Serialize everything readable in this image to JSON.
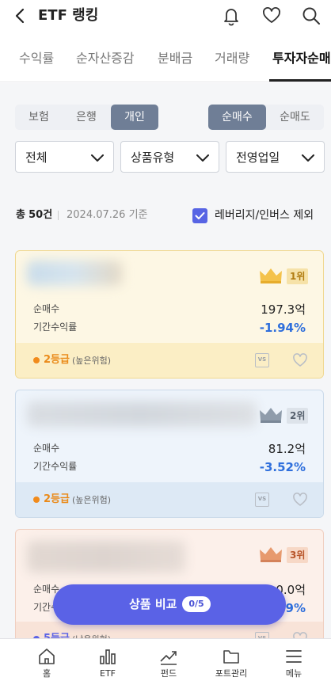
{
  "header": {
    "title": "ETF 랭킹"
  },
  "tabs": [
    {
      "label": "수익률"
    },
    {
      "label": "순자산증감"
    },
    {
      "label": "분배금"
    },
    {
      "label": "거래량"
    },
    {
      "label": "투자자순매"
    }
  ],
  "filters": {
    "investor": [
      "보험",
      "은행",
      "개인"
    ],
    "investor_selected": "개인",
    "trade": [
      "순매수",
      "순매도"
    ],
    "trade_selected": "순매수",
    "dropdowns": [
      {
        "label": "전체"
      },
      {
        "label": "상품유형"
      },
      {
        "label": "전영업일"
      }
    ]
  },
  "summary": {
    "count_prefix": "총",
    "count": "50건",
    "date": "2024.07.26 기준",
    "exclude_label": "레버리지/인버스 제외"
  },
  "cards": [
    {
      "rank": "1위",
      "net_label": "순매수",
      "net_value": "197.3억",
      "return_label": "기간수익률",
      "return_value": "-1.94%",
      "grade": "2등급",
      "grade_note": "(높은위험)",
      "vs": "VS",
      "theme": "gold"
    },
    {
      "rank": "2위",
      "net_label": "순매수",
      "net_value": "81.2억",
      "return_label": "기간수익률",
      "return_value": "-3.52%",
      "grade": "2등급",
      "grade_note": "(높은위험)",
      "vs": "VS",
      "theme": "silver"
    },
    {
      "rank": "3위",
      "net_label": "순매수",
      "net_value": "0.0억",
      "return_label": "기간수익률",
      "return_value": "9%",
      "grade": "5등급",
      "grade_note": "(낮은위험)",
      "vs": "VS",
      "theme": "bronze"
    }
  ],
  "compare": {
    "label": "상품 비교",
    "badge": "0/5"
  },
  "nav": [
    {
      "label": "홈",
      "icon": "home-icon"
    },
    {
      "label": "ETF",
      "icon": "bar-chart-icon"
    },
    {
      "label": "펀드",
      "icon": "trend-icon"
    },
    {
      "label": "포트관리",
      "icon": "folder-icon"
    },
    {
      "label": "메뉴",
      "icon": "menu-icon"
    }
  ],
  "colors": {
    "accent": "#5a62e6",
    "negative": "#2f6fdc",
    "grade": "#ea8a19",
    "gold": "#fdf7e4",
    "silver": "#eef4fb",
    "bronze": "#fcf0ea"
  }
}
